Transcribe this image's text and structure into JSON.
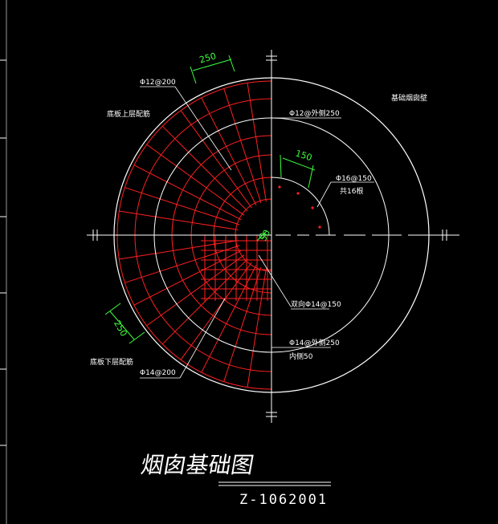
{
  "drawing": {
    "title": "烟囱基础图",
    "code": "Z-1062001"
  },
  "annotations": {
    "top_bars": "Φ12@200",
    "top_layer_label": "底板上层配筋",
    "top_ring": "Φ12@外侧250",
    "cylinder_label": "基础烟囱壁",
    "anchor_bars": "Φ16@150",
    "anchor_count": "共16根",
    "center_bars": "双向Φ14@150",
    "bottom_ring": "Φ14@外侧250",
    "bottom_inner": "内侧50",
    "bottom_layer_label": "底板下层配筋",
    "bottom_bars": "Φ14@200",
    "dim_top": "250",
    "dim_anchor": "150",
    "dim_bottom": "250",
    "dim_center": "50"
  },
  "colors": {
    "background": "#000000",
    "outline": "#ffffff",
    "rebar": "#ff2020",
    "dimension": "#3cff3c"
  }
}
